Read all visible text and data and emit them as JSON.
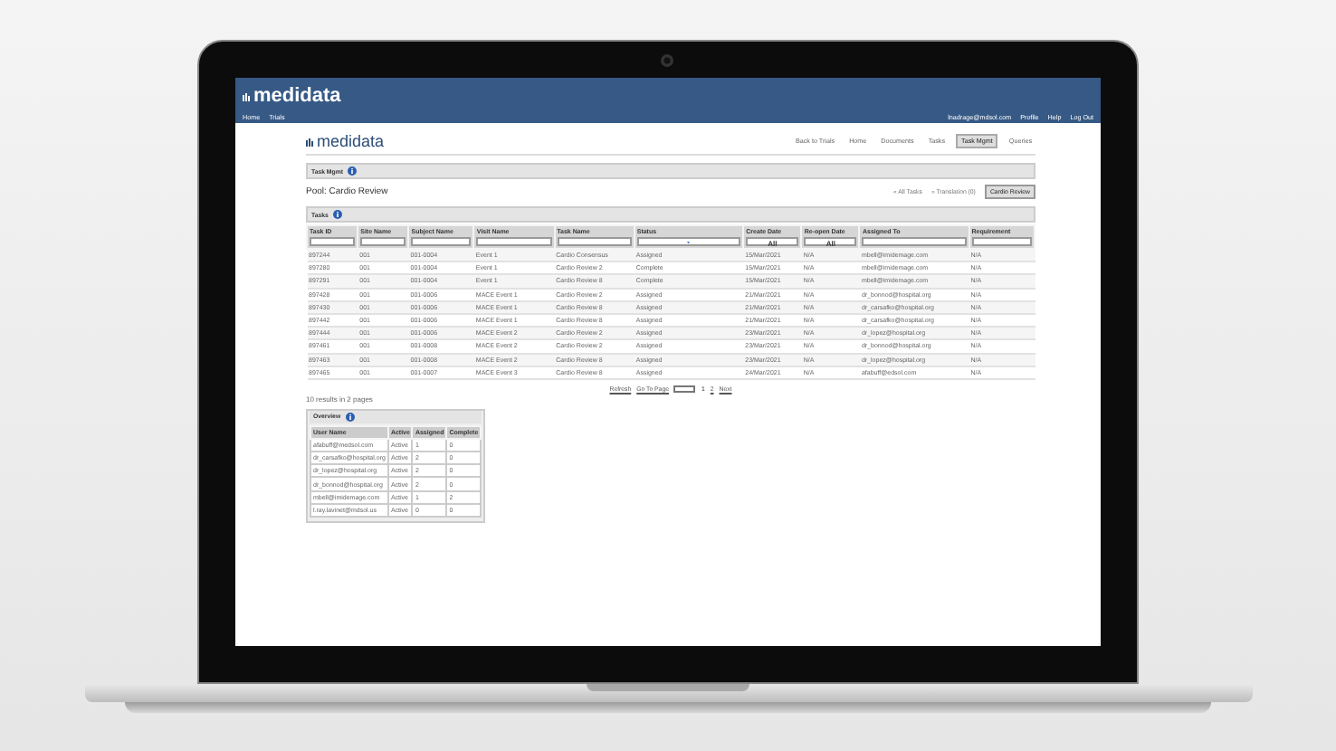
{
  "app_header": {
    "logo": "medidata",
    "nav": [
      "Home",
      "Trials"
    ],
    "user": "lnadrage@mdsol.com",
    "links": [
      "Profile",
      "Help",
      "Log Out"
    ]
  },
  "page": {
    "logo": "medidata",
    "nav": [
      {
        "label": "Back to Trials",
        "selected": false
      },
      {
        "label": "Home",
        "selected": false
      },
      {
        "label": "Documents",
        "selected": false
      },
      {
        "label": "Tasks",
        "selected": false
      },
      {
        "label": "Task Mgmt",
        "selected": true
      },
      {
        "label": "Queries",
        "selected": false
      }
    ],
    "task_mgmt_title": "Task Mgmt",
    "pool": "Pool: Cardio Review",
    "pool_links": [
      "« All Tasks",
      "» Translation (0)"
    ],
    "pool_button": "Cardio Review",
    "tasks_title": "Tasks",
    "table": {
      "columns": [
        {
          "label": "Task ID",
          "kind": "text"
        },
        {
          "label": "Site Name",
          "kind": "text"
        },
        {
          "label": "Subject Name",
          "kind": "text"
        },
        {
          "label": "Visit Name",
          "kind": "text"
        },
        {
          "label": "Task Name",
          "kind": "text"
        },
        {
          "label": "Status",
          "kind": "select"
        },
        {
          "label": "Create Date",
          "kind": "select",
          "value": "All"
        },
        {
          "label": "Re-open Date",
          "kind": "select",
          "value": "All"
        },
        {
          "label": "Assigned To",
          "kind": "text"
        },
        {
          "label": "Requirement",
          "kind": "text"
        }
      ],
      "rows": [
        [
          "897244",
          "001",
          "001-0004",
          "Event 1",
          "Cardio Consensus",
          "Assigned",
          "15/Mar/2021",
          "N/A",
          "mbell@imidemage.com",
          "N/A"
        ],
        [
          "897280",
          "001",
          "001-0004",
          "Event 1",
          "Cardio Review 2",
          "Complete",
          "15/Mar/2021",
          "N/A",
          "mbell@imidemage.com",
          "N/A"
        ],
        [
          "897291",
          "001",
          "001-0004",
          "Event 1",
          "Cardio Review 8",
          "Complete",
          "15/Mar/2021",
          "N/A",
          "mbell@imidemage.com",
          "N/A"
        ],
        [
          "897428",
          "001",
          "001-0006",
          "MACE Event 1",
          "Cardio Review 2",
          "Assigned",
          "21/Mar/2021",
          "N/A",
          "dr_bonnod@hospital.org",
          "N/A"
        ],
        [
          "897430",
          "001",
          "001-0006",
          "MACE Event 1",
          "Cardio Review 8",
          "Assigned",
          "21/Mar/2021",
          "N/A",
          "dr_carsafko@hospital.org",
          "N/A"
        ],
        [
          "897442",
          "001",
          "001-0006",
          "MACE Event 1",
          "Cardio Review 8",
          "Assigned",
          "21/Mar/2021",
          "N/A",
          "dr_carsafko@hospital.org",
          "N/A"
        ],
        [
          "897444",
          "001",
          "001-0006",
          "MACE Event 2",
          "Cardio Review 2",
          "Assigned",
          "23/Mar/2021",
          "N/A",
          "dr_lopez@hospital.org",
          "N/A"
        ],
        [
          "897461",
          "001",
          "001-0008",
          "MACE Event 2",
          "Cardio Review 2",
          "Assigned",
          "23/Mar/2021",
          "N/A",
          "dr_bonnod@hospital.org",
          "N/A"
        ],
        [
          "897463",
          "001",
          "001-0008",
          "MACE Event 2",
          "Cardio Review 8",
          "Assigned",
          "23/Mar/2021",
          "N/A",
          "dr_lopez@hospital.org",
          "N/A"
        ],
        [
          "897465",
          "001",
          "001-0007",
          "MACE Event 3",
          "Cardio Review 8",
          "Assigned",
          "24/Mar/2021",
          "N/A",
          "afabuff@edsol.com",
          "N/A"
        ]
      ]
    },
    "pager": {
      "refresh": "Refresh",
      "go_to_page": "Go To Page",
      "pages": [
        {
          "label": "1",
          "selected": true
        },
        {
          "label": "2",
          "selected": false
        }
      ],
      "next": "Next"
    },
    "results": "10 results in 2 pages",
    "overview": {
      "title": "Overview",
      "columns": [
        "User Name",
        "Active",
        "Assigned",
        "Complete"
      ],
      "rows": [
        [
          "afabuff@medsol.com",
          "Active",
          "1",
          "0"
        ],
        [
          "dr_carsafko@hospital.org",
          "Active",
          "2",
          "0"
        ],
        [
          "dr_lopez@hospital.org",
          "Active",
          "2",
          "0"
        ],
        [
          "dr_bonnod@hospital.org",
          "Active",
          "2",
          "0"
        ],
        [
          "mbell@imidemage.com",
          "Active",
          "1",
          "2"
        ],
        [
          "l.ray.lavinet@mdsol.us",
          "Active",
          "0",
          "0"
        ]
      ]
    }
  }
}
